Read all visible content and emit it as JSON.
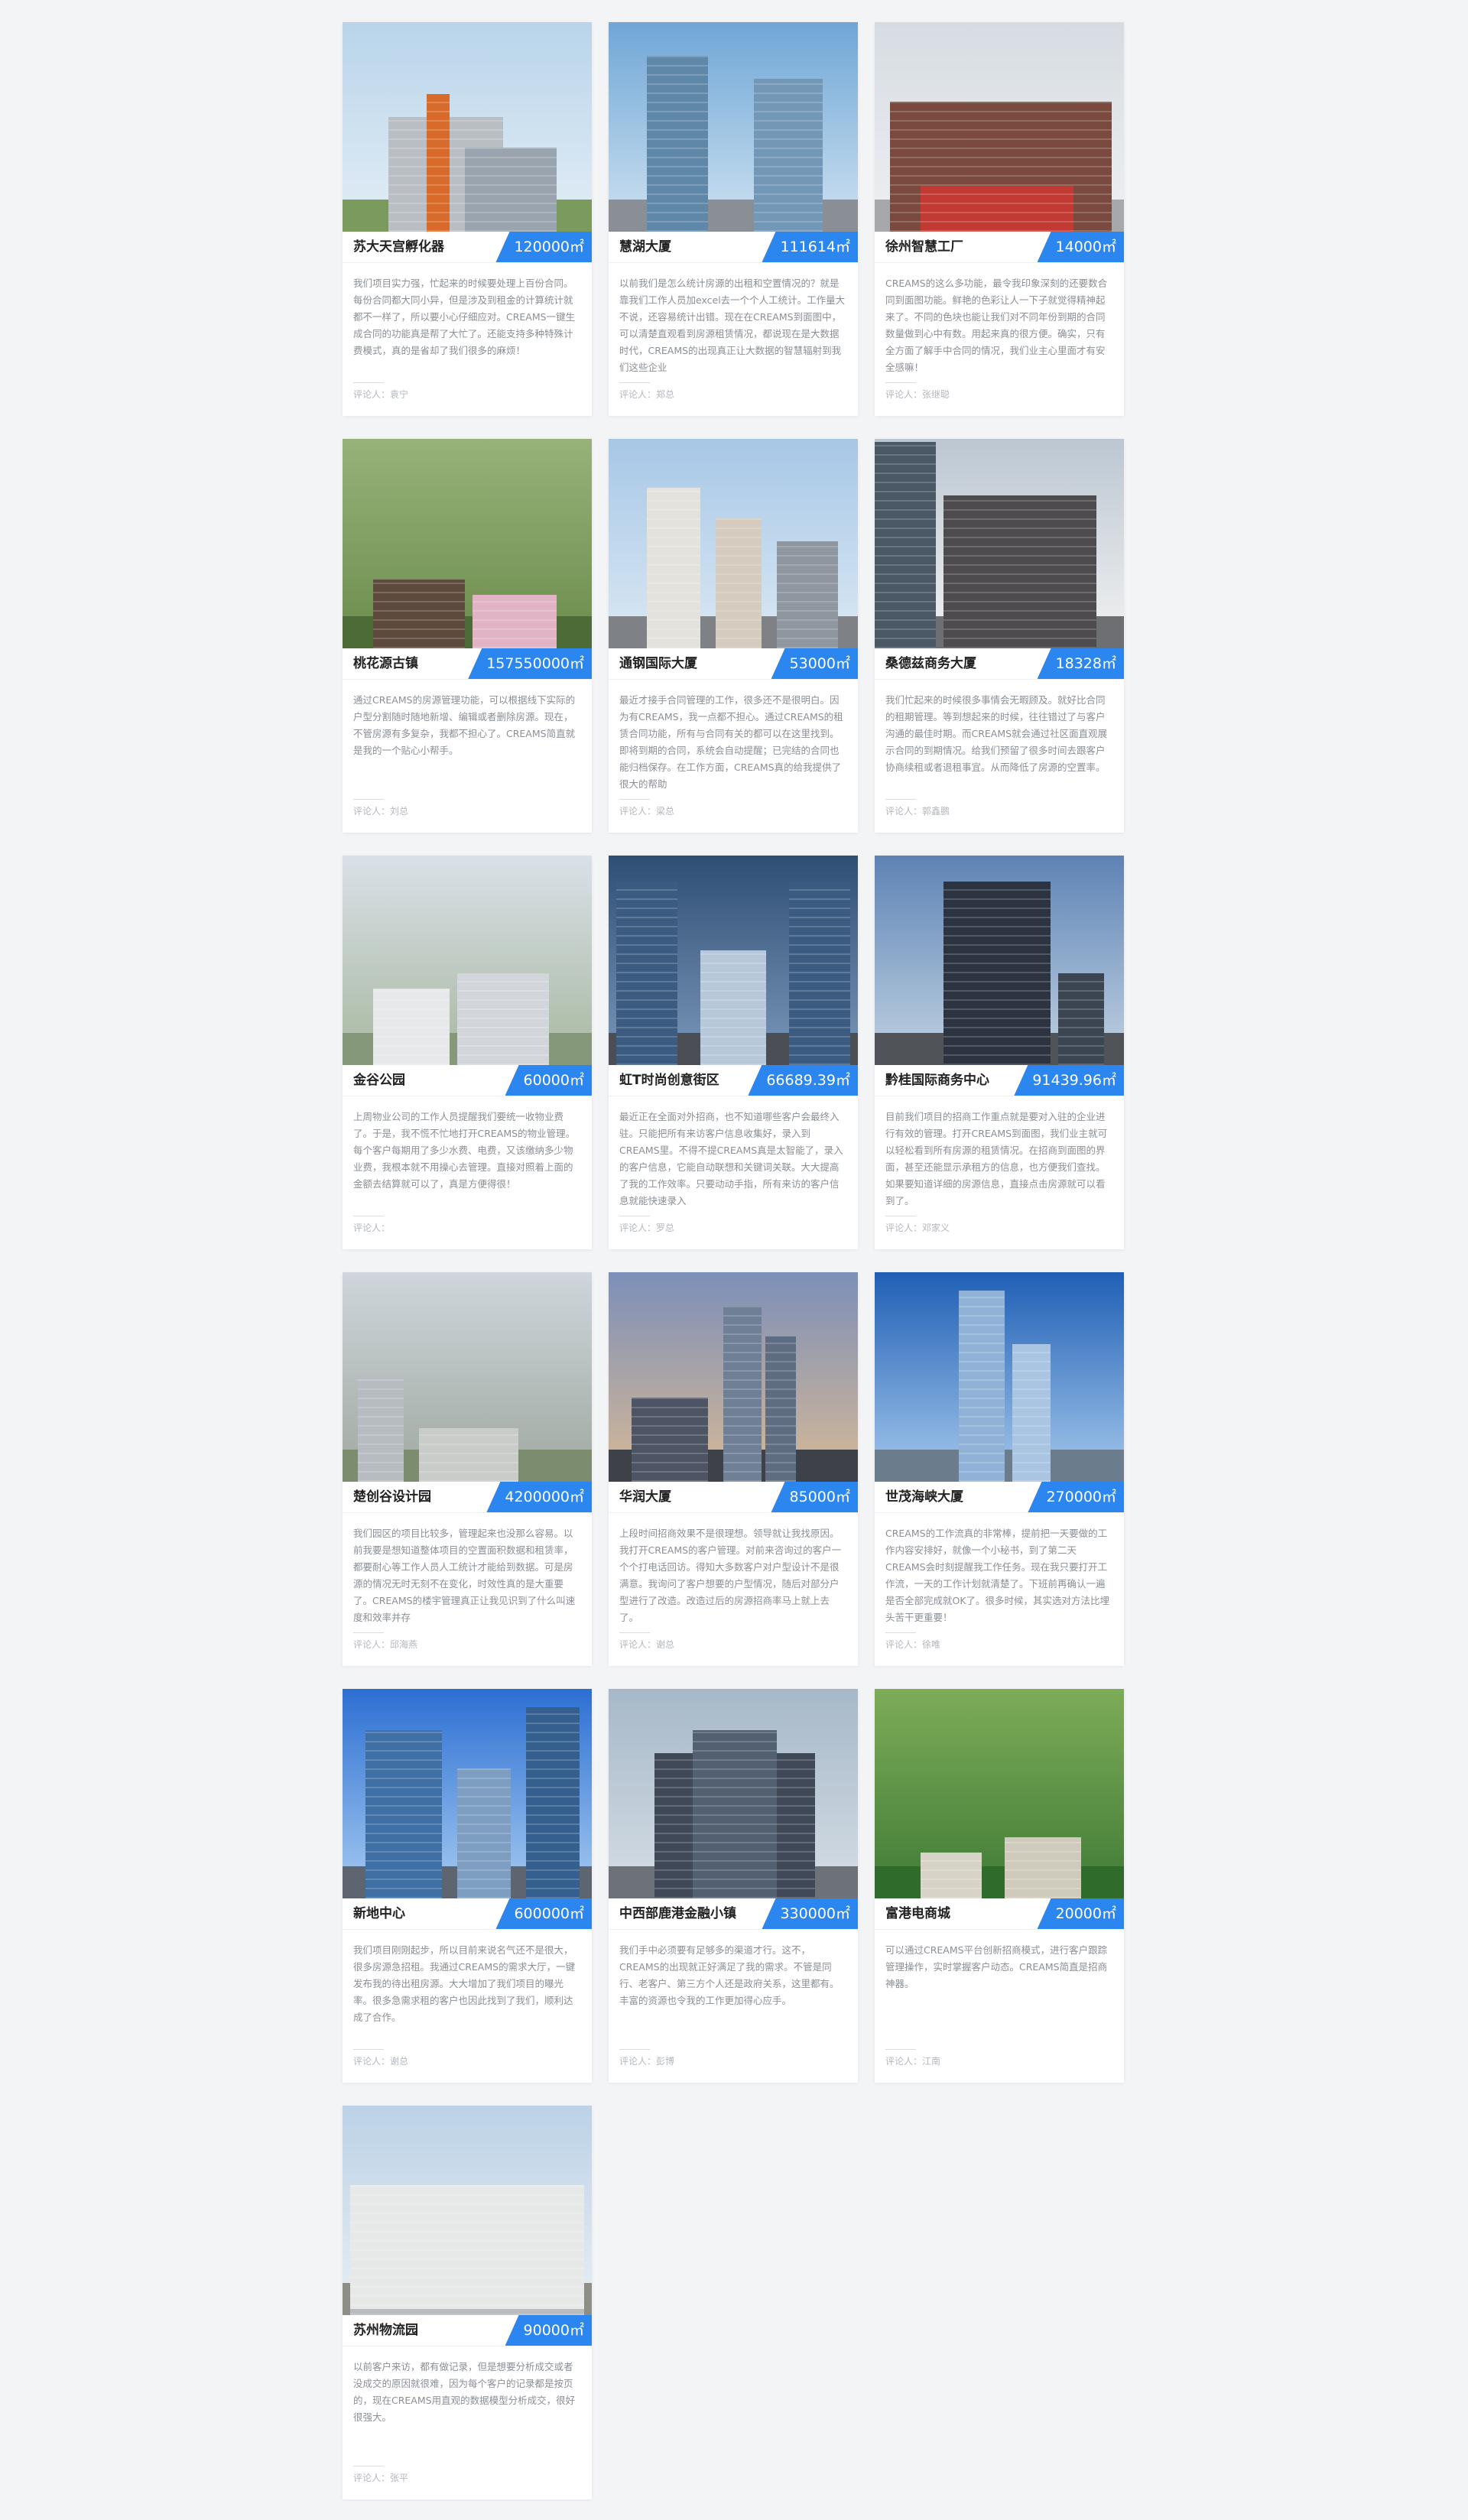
{
  "labels": {
    "author_prefix": "评论人："
  },
  "cards": [
    {
      "name": "苏大天宫孵化器",
      "area": "120000㎡",
      "desc": "我们项目实力强，忙起来的时候要处理上百份合同。每份合同都大同小异，但是涉及到租金的计算统计就都不一样了，所以要小心仔细应对。CREAMS一键生成合同的功能真是帮了大忙了。还能支持多种特殊计费模式，真的是省却了我们很多的麻烦！",
      "author": "袁宁",
      "theme": "campus"
    },
    {
      "name": "慧湖大厦",
      "area": "111614㎡",
      "desc": "以前我们是怎么统计房源的出租和空置情况的？就是靠我们工作人员加excel去一个个人工统计。工作量大不说，还容易统计出错。现在在CREAMS到面图中，可以清楚直观看到房源租赁情况，都说现在是大数据时代，CREAMS的出现真正让大数据的智慧辐射到我们这些企业",
      "author": "郑总",
      "theme": "towers"
    },
    {
      "name": "徐州智慧工厂",
      "area": "14000㎡",
      "desc": "CREAMS的这么多功能，最令我印象深刻的还要数合同到面图功能。鲜艳的色彩让人一下子就觉得精神起来了。不同的色块也能让我们对不同年份到期的合同数量做到心中有数。用起来真的很方便。确实，只有全方面了解手中合同的情况，我们业主心里面才有安全感嘛！",
      "author": "张继聪",
      "theme": "factory"
    },
    {
      "name": "桃花源古镇",
      "area": "157550000㎡",
      "desc": "通过CREAMS的房源管理功能，可以根据线下实际的户型分割随时随地新增、编辑或者删除房源。现在，不管房源有多复杂，我都不担心了。CREAMS简直就是我的一个贴心小帮手。",
      "author": "刘总",
      "theme": "village"
    },
    {
      "name": "通钢国际大厦",
      "area": "53000㎡",
      "desc": "最近才接手合同管理的工作，很多还不是很明白。因为有CREAMS，我一点都不担心。通过CREAMS的租赁合同功能，所有与合同有关的都可以在这里找到。即将到期的合同，系统会自动提醒；已完结的合同也能归档保存。在工作方面，CREAMS真的给我提供了很大的帮助",
      "author": "梁总",
      "theme": "city"
    },
    {
      "name": "桑德兹商务大厦",
      "area": "18328㎡",
      "desc": "我们忙起来的时候很多事情会无暇顾及。就好比合同的租期管理。等到想起来的时候，往往错过了与客户沟通的最佳时期。而CREAMS就会通过社区面直观展示合同的到期情况。给我们预留了很多时间去跟客户协商续租或者退租事宜。从而降低了房源的空置率。",
      "author": "郭鑫鹏",
      "theme": "glassblock"
    },
    {
      "name": "金谷公园",
      "area": "60000㎡",
      "desc": "上周物业公司的工作人员提醒我们要统一收物业费了。于是，我不慌不忙地打开CREAMS的物业管理。每个客户每期用了多少水费、电费，又该缴纳多少物业费，我根本就不用操心去管理。直接对照着上面的金额去结算就可以了，真是方便得很！",
      "author": "",
      "theme": "aerial"
    },
    {
      "name": "虹T时尚创意街区",
      "area": "66689.39㎡",
      "desc": "最近正在全面对外招商，也不知道哪些客户会最终入驻。只能把所有来访客户信息收集好，录入到CREAMS里。不得不提CREAMS真是太智能了，录入的客户信息，它能自动联想和关键词关联。大大提高了我的工作效率。只要动动手指，所有来访的客户信息就能快速录入",
      "author": "罗总",
      "theme": "mall"
    },
    {
      "name": "黔桂国际商务中心",
      "area": "91439.96㎡",
      "desc": "目前我们项目的招商工作重点就是要对入驻的企业进行有效的管理。打开CREAMS到面图，我们业主就可以轻松看到所有房源的租赁情况。在招商到面图的界面，甚至还能显示承租方的信息，也方便我们查找。如果要知道详细的房源信息，直接点击房源就可以看到了。",
      "author": "邓家义",
      "theme": "darktower"
    },
    {
      "name": "楚创谷设计园",
      "area": "4200000㎡",
      "desc": "我们园区的项目比较多，管理起来也没那么容易。以前我要是想知道整体项目的空置面积数据和租赁率，都要耐心等工作人员人工统计才能给到数据。可是房源的情况无时无刻不在变化，时效性真的是大重要了。CREAMS的楼宇管理真正让我见识到了什么叫速度和效率并存",
      "author": "邱海燕",
      "theme": "roundabout"
    },
    {
      "name": "华润大厦",
      "area": "85000㎡",
      "desc": "上段时间招商效果不是很理想。领导就让我找原因。我打开CREAMS的客户管理。对前来咨询过的客户一个个打电话回访。得知大多数客户对户型设计不是很满意。我询问了客户想要的户型情况，随后对部分户型进行了改造。改造过后的房源招商率马上就上去了。",
      "author": "谢总",
      "theme": "dusk"
    },
    {
      "name": "世茂海峡大厦",
      "area": "270000㎡",
      "desc": "CREAMS的工作流真的非常棒，提前把一天要做的工作内容安排好，就像一个小秘书，到了第二天CREAMS会时刻提醒我工作任务。现在我只要打开工作流，一天的工作计划就清楚了。下班前再确认一遍是否全部完成就OK了。很多时候，其实选对方法比埋头苦干更重要！",
      "author": "徐唯",
      "theme": "twin"
    },
    {
      "name": "新地中心",
      "area": "600000㎡",
      "desc": "我们项目刚刚起步，所以目前来说名气还不是很大，很多房源急招租。我通过CREAMS的需求大厅，一键发布我的待出租房源。大大增加了我们项目的曝光率。很多急需求租的客户也因此找到了我们，顺利达成了合作。",
      "author": "谢总",
      "theme": "bluesky"
    },
    {
      "name": "中西部鹿港金融小镇",
      "area": "330000㎡",
      "desc": "我们手中必须要有足够多的渠道才行。这不，CREAMS的出现就正好满足了我的需求。不管是同行、老客户、第三方个人还是政府关系，这里都有。丰富的资源也令我的工作更加得心应手。",
      "author": "彭博",
      "theme": "curved"
    },
    {
      "name": "富港电商城",
      "area": "20000㎡",
      "desc": "可以通过CREAMS平台创新招商模式，进行客户跟踪管理操作，实时掌握客户动态。CREAMS简直是招商神器。",
      "author": "江南",
      "theme": "green"
    },
    {
      "name": "苏州物流园",
      "area": "90000㎡",
      "desc": "以前客户来访，都有做记录，但是想要分析成交或者没成交的原因就很难，因为每个客户的记录都是按页的，现在CREAMS用直观的数据模型分析成交，很好很强大。",
      "author": "张平",
      "theme": "hospital"
    }
  ]
}
